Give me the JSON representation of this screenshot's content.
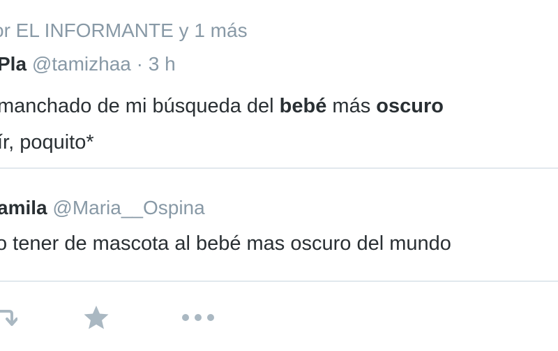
{
  "retweet_context": "or EL INFORMANTE y 1 más",
  "tweet": {
    "author_name": "Pla",
    "handle": "@tamizhaa",
    "separator": "·",
    "time": "3 h",
    "line1_a": " manchado de mi búsqueda del ",
    "line1_b": "bebé",
    "line1_c": " más ",
    "line1_d": "oscuro",
    "line2": "ír, poquito*"
  },
  "quoted_tweet": {
    "author_name": "amila",
    "handle": "@Maria__Ospina",
    "text": "o tener de mascota al bebé mas oscuro del mundo"
  },
  "actions": {
    "retweet_icon": "retweet-icon",
    "like_icon": "star-icon",
    "more_icon": "more-icon"
  },
  "colors": {
    "text": "#292f33",
    "muted": "#8899a6",
    "divider": "#e1e8ed",
    "icon": "#aab8c2"
  }
}
